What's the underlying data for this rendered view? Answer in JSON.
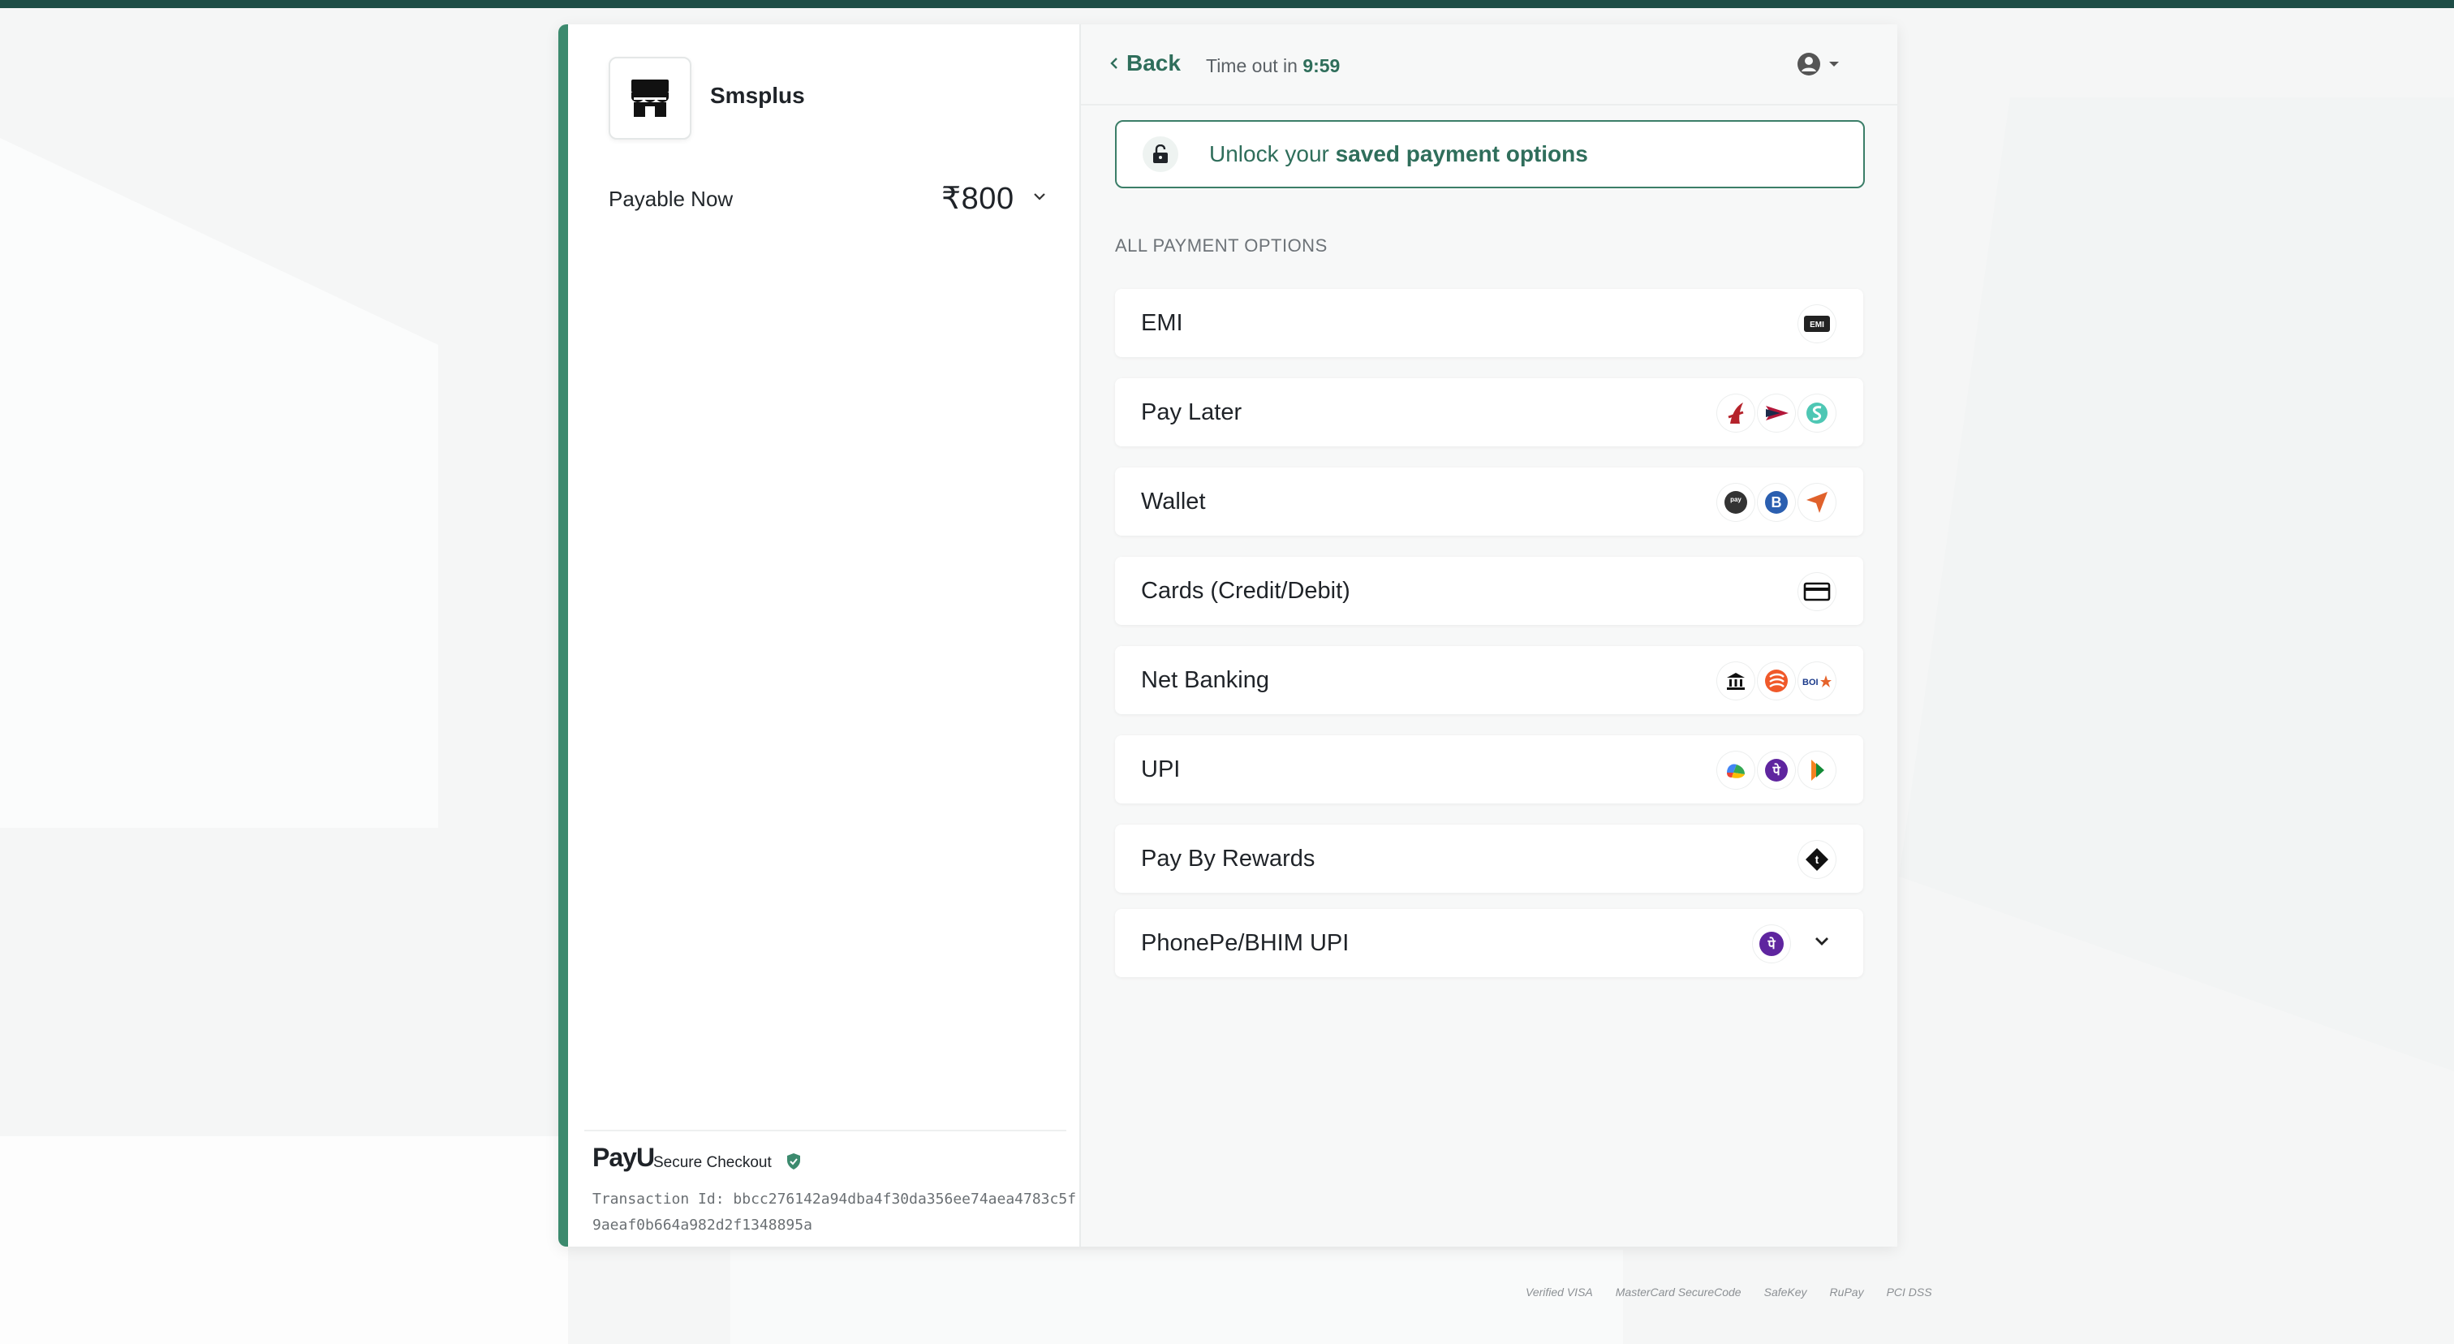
{
  "merchant": {
    "name": "Smsplus"
  },
  "payable": {
    "label": "Payable Now",
    "amount": "₹800"
  },
  "footer": {
    "brand": "PayU",
    "secure_label": "Secure Checkout",
    "transaction": "Transaction Id: bbcc276142a94dba4f30da356ee74aea4783c5f9aeaf0b664a982d2f1348895a"
  },
  "header": {
    "back_label": "Back",
    "timeout_prefix": "Time out in",
    "timeout_value": "9:59"
  },
  "unlock": {
    "prefix": "Unlock your ",
    "strong": "saved payment options"
  },
  "section_title": "ALL PAYMENT OPTIONS",
  "options": [
    {
      "label": "EMI",
      "icons": [
        "emi-icon"
      ]
    },
    {
      "label": "Pay Later",
      "icons": [
        "bank-logo-icon",
        "pay-later-arrow-icon",
        "simpl-icon"
      ]
    },
    {
      "label": "Wallet",
      "icons": [
        "pay-wallet-icon",
        "b-wallet-icon",
        "send-wallet-icon"
      ]
    },
    {
      "label": "Cards (Credit/Debit)",
      "icons": [
        "card-icon"
      ]
    },
    {
      "label": "Net Banking",
      "icons": [
        "bank-building-icon",
        "bank-of-baroda-icon",
        "boi-icon"
      ]
    },
    {
      "label": "UPI",
      "icons": [
        "google-pay-icon",
        "phonepe-icon",
        "bhim-icon"
      ]
    },
    {
      "label": "Pay By Rewards",
      "icons": [
        "rewards-icon"
      ]
    },
    {
      "label": "PhonePe/BHIM UPI",
      "icons": [
        "phonepe-icon"
      ]
    }
  ],
  "trust_badges": [
    "Verified VISA",
    "MasterCard SecureCode",
    "SafeKey",
    "RuPay",
    "PCI DSS"
  ],
  "colors": {
    "accent": "#2f6e5b",
    "topbar": "#1e4d46",
    "left_stripe": "#3c8a6e"
  }
}
